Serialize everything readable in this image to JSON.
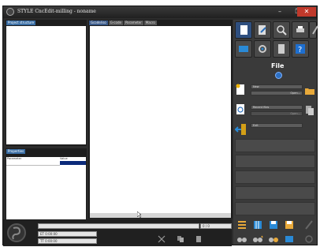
{
  "window": {
    "title": "STYLE CncEdit-milling - noname"
  },
  "left_panel": {
    "header": "Project structure"
  },
  "properties": {
    "header": "Properties",
    "columns": [
      "Parameter",
      "Value"
    ]
  },
  "editor": {
    "tabs": [
      "Gcode/iso",
      "G-code",
      "Parameter",
      "Macro"
    ]
  },
  "status": {
    "coord": "0 / 0",
    "et": "ET 0:00:00",
    "tt": "TT 0:00:00"
  },
  "right_panel": {
    "section": "File",
    "new_label": "New",
    "open_label": "Open...",
    "recent_label": "Recent files",
    "recent_open": "Open...",
    "exit_label": "Exit"
  },
  "colors": {
    "accent": "#3a6ea5",
    "close": "#c0392b",
    "toolbar_bg": "#4a4a4a",
    "selection": "#0b2a7a"
  }
}
